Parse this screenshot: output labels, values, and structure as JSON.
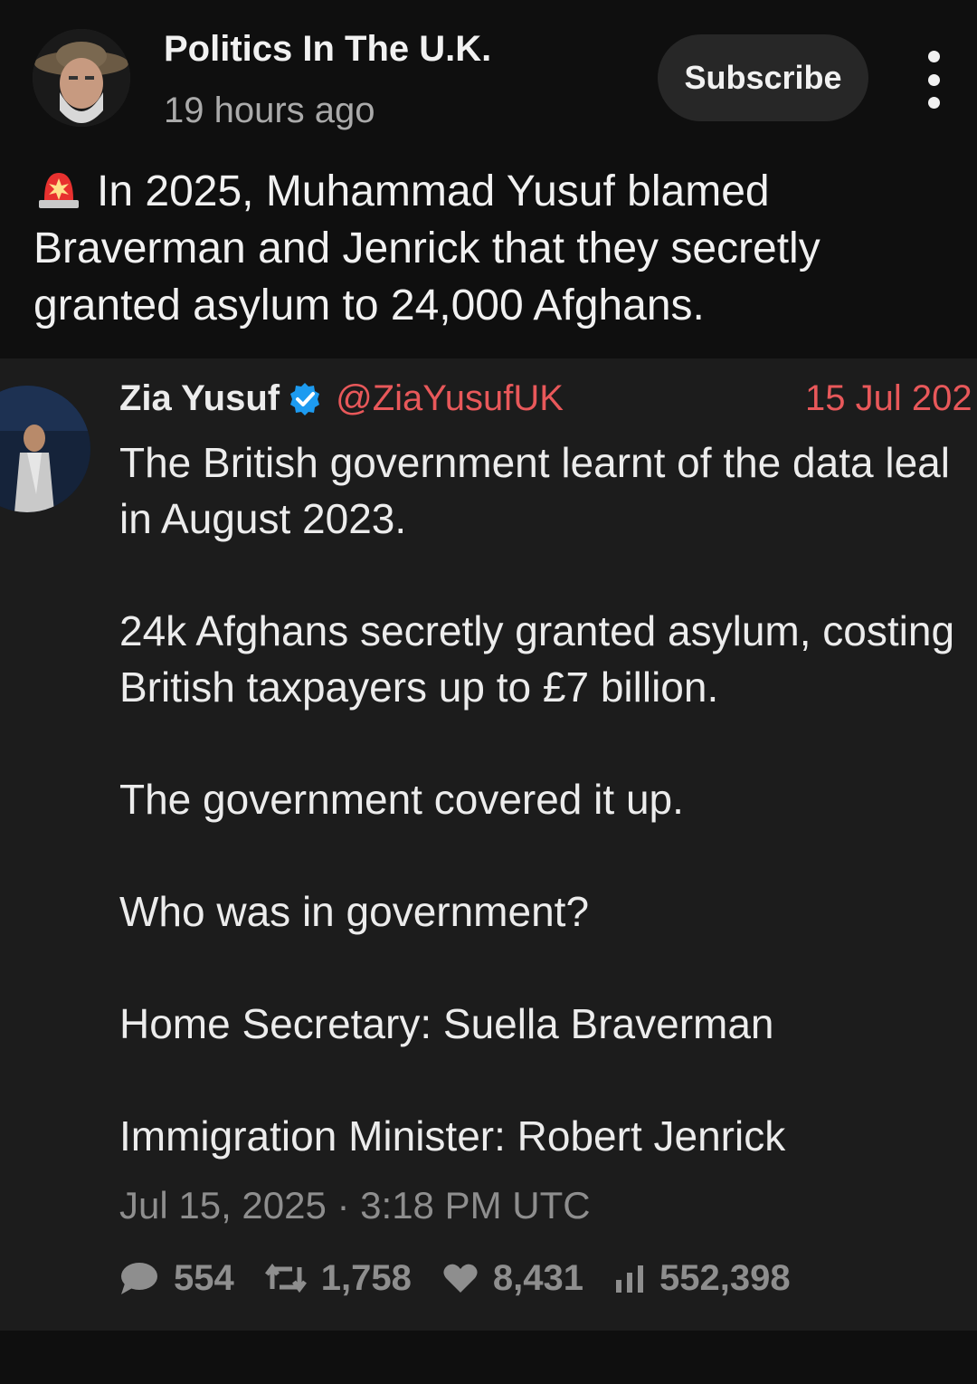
{
  "post": {
    "channel_name": "Politics In The U.K.",
    "timestamp": "19 hours ago",
    "subscribe_label": "Subscribe",
    "text_icon": "siren-icon",
    "text": "In 2025, Muhammad Yusuf blamed Braverman and Jenrick that they secretly granted asylum to 24,000 Afghans."
  },
  "tweet": {
    "author_name": "Zia Yusuf",
    "verified_icon": "verified-badge-icon",
    "handle": "@ZiaYusufUK",
    "date": "15 Jul 202",
    "paragraphs": [
      "The British government learnt of the data leal\nin August 2023.",
      "24k Afghans secretly granted asylum, costing\nBritish taxpayers up to £7 billion.",
      "The government covered it up.",
      "Who was in government?",
      "Home Secretary: Suella Braverman",
      "Immigration Minister: Robert Jenrick"
    ],
    "posted_at": "Jul 15, 2025 · 3:18 PM UTC",
    "stats": {
      "replies": "554",
      "retweets": "1,758",
      "likes": "8,431",
      "views": "552,398"
    }
  },
  "colors": {
    "background": "#0f0f0f",
    "card": "#1c1c1c",
    "handle_red": "#e8585a",
    "verified_blue": "#1d9bf0"
  }
}
